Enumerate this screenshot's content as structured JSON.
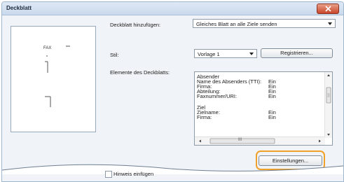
{
  "window": {
    "title": "Deckblatt"
  },
  "preview": {
    "rows": [
      "FAX",
      "— ",
      "—"
    ]
  },
  "form": {
    "add_label": "Deckblatt hinzufügen:",
    "add_value": "Gleiches Blatt an alle Ziele senden",
    "style_label": "Stil:",
    "style_value": "Vorlage 1",
    "register_button": "Registrieren...",
    "elements_label": "Elemente des Deckblatts:"
  },
  "elements_list": {
    "rows": [
      {
        "label": "Absender",
        "value": ""
      },
      {
        "label": "Name des Absenders (TTI):",
        "value": "Ein"
      },
      {
        "label": "Firma:",
        "value": "Ein"
      },
      {
        "label": "Abteilung:",
        "value": "Ein"
      },
      {
        "label": "Faxnummer/URI:",
        "value": "Ein"
      },
      {
        "label": "",
        "value": ""
      },
      {
        "label": "Ziel",
        "value": ""
      },
      {
        "label": "Zielname:",
        "value": "Ein"
      },
      {
        "label": "Firma:",
        "value": "Ein"
      }
    ],
    "hscroll_thumb": "III"
  },
  "settings_button": "Einstellungen...",
  "checkbox_label": "Hinweis einfügen",
  "colors": {
    "highlight": "#f0a12a",
    "close": "#c7452a"
  }
}
